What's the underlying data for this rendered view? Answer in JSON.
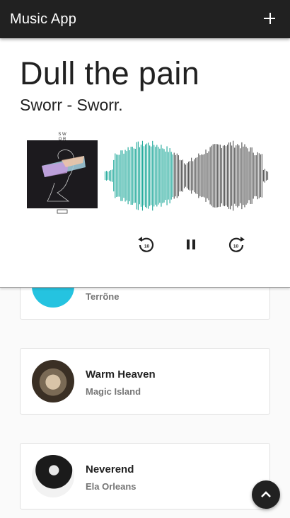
{
  "app": {
    "title": "Music App"
  },
  "now_playing": {
    "title": "Dull the pain",
    "artist_line": "Sworr - Sworr.",
    "cover_icon": "album-cover",
    "progress": 0.42,
    "accent_played": "#1fa99a",
    "accent_unplayed": "#555555"
  },
  "controls": {
    "rewind": "replay-10-icon",
    "pause": "pause-icon",
    "forward": "forward-10-icon"
  },
  "songs": [
    {
      "title": "",
      "artist": "Terrõne"
    },
    {
      "title": "Warm Heaven",
      "artist": "Magic Island"
    },
    {
      "title": "Neverend",
      "artist": "Ela Orleans"
    }
  ],
  "fab": {
    "icon": "chevron-up-icon"
  }
}
